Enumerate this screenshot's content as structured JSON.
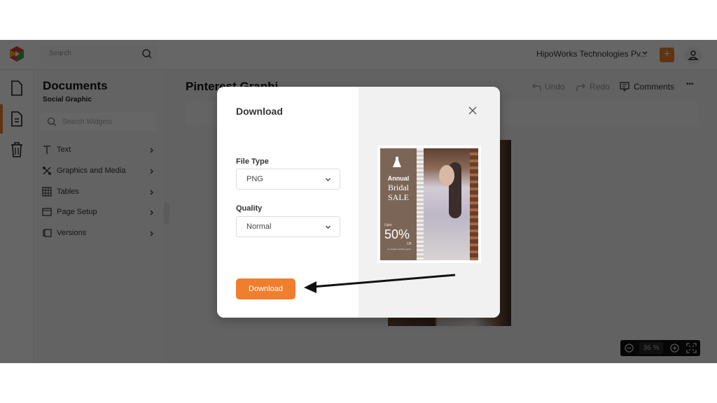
{
  "topbar": {
    "search_placeholder": "Search",
    "org_name": "HipoWorks Technologies Pv...",
    "add_label": "+"
  },
  "panel": {
    "title": "Documents",
    "subtitle": "Social Graphic",
    "search_placeholder": "Search Widgets",
    "items": [
      {
        "label": "Text",
        "icon": "text-icon"
      },
      {
        "label": "Graphics and Media",
        "icon": "graphics-icon"
      },
      {
        "label": "Tables",
        "icon": "table-icon"
      },
      {
        "label": "Page Setup",
        "icon": "page-setup-icon"
      },
      {
        "label": "Versions",
        "icon": "versions-icon"
      }
    ]
  },
  "header": {
    "doc_title": "Pinterest Graphi",
    "undo": "Undo",
    "redo": "Redo",
    "comments": "Comments",
    "more": "•••"
  },
  "zoom": {
    "value": "36",
    "unit": "%"
  },
  "modal": {
    "title": "Download",
    "file_type_label": "File Type",
    "file_type_value": "PNG",
    "quality_label": "Quality",
    "quality_value": "Normal",
    "download_label": "Download",
    "preview": {
      "line1": "Annual",
      "line2": "Bridal",
      "line3": "SALE",
      "upto": "Upto",
      "percent": "50%",
      "off": "Off",
      "fine_print": "on elegant wedding gown"
    }
  },
  "colors": {
    "accent": "#ef7f2e",
    "overlay": "rgba(0,0,0,0.6)",
    "preview_brown": "#7b6557"
  }
}
